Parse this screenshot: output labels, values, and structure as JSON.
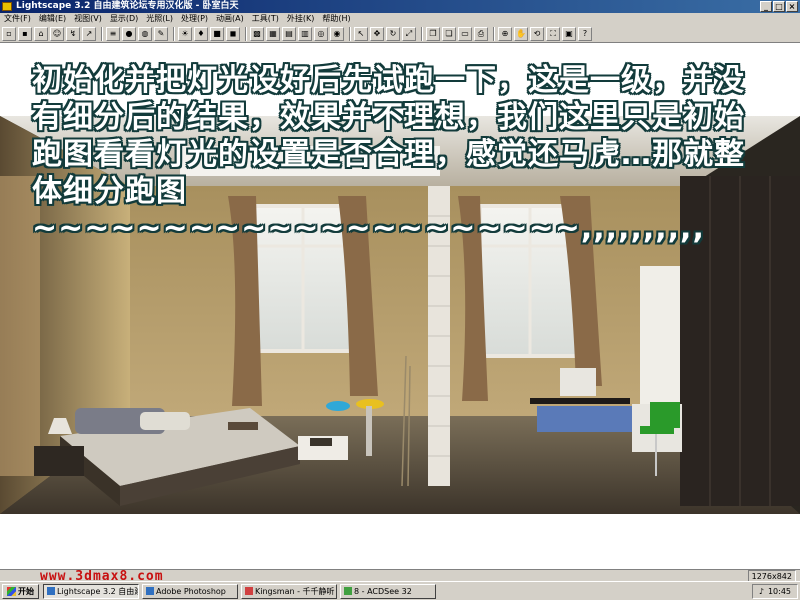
{
  "window": {
    "title": "Lightscape 3.2 自由建筑论坛专用汉化版 - 卧室白天"
  },
  "menu": [
    "文件(F)",
    "编辑(E)",
    "视图(V)",
    "显示(D)",
    "光照(L)",
    "处理(P)",
    "动画(A)",
    "工具(T)",
    "外挂(K)",
    "帮助(H)"
  ],
  "toolbar_icons": [
    "new-icon",
    "open-icon",
    "save-icon",
    "walk-icon",
    "person-icon",
    "arrow-icon",
    "layers-icon",
    "sphere-icon",
    "globe-icon",
    "pen-icon",
    "light-icon",
    "lamp-icon",
    "box-icon",
    "cube-icon",
    "solid-icon",
    "wire-icon",
    "grid-icon",
    "table-icon",
    "view-icon",
    "camera-icon",
    "select-icon",
    "move-icon",
    "rotate-icon",
    "scale-icon",
    "copy-icon",
    "paste-icon",
    "doc-icon",
    "print-icon",
    "zoom-icon",
    "pan-icon",
    "orbit-icon",
    "fit-icon",
    "window-icon",
    "help-icon"
  ],
  "caption": "初始化并把灯光设好后先试跑一下，这是一级，并没有细分后的结果，效果并不理想，我们这里只是初始跑图看看灯光的设置是否合理，感觉还马虎…那就整体细分跑图 ~~~~~~~~~~~~~~~~~~~~~,,,,,,,,,,",
  "watermark": "www.3dmax8.com",
  "statusbar": {
    "resolution": "1276x842"
  },
  "taskbar": {
    "start": "开始",
    "tasks": [
      {
        "label": "Lightscape 3.2 自由建筑...",
        "active": true
      },
      {
        "label": "Adobe Photoshop",
        "active": false
      },
      {
        "label": "Kingsman - 千千静听",
        "active": false
      },
      {
        "label": "8 - ACDSee 32",
        "active": false
      }
    ],
    "clock": "10:45"
  }
}
